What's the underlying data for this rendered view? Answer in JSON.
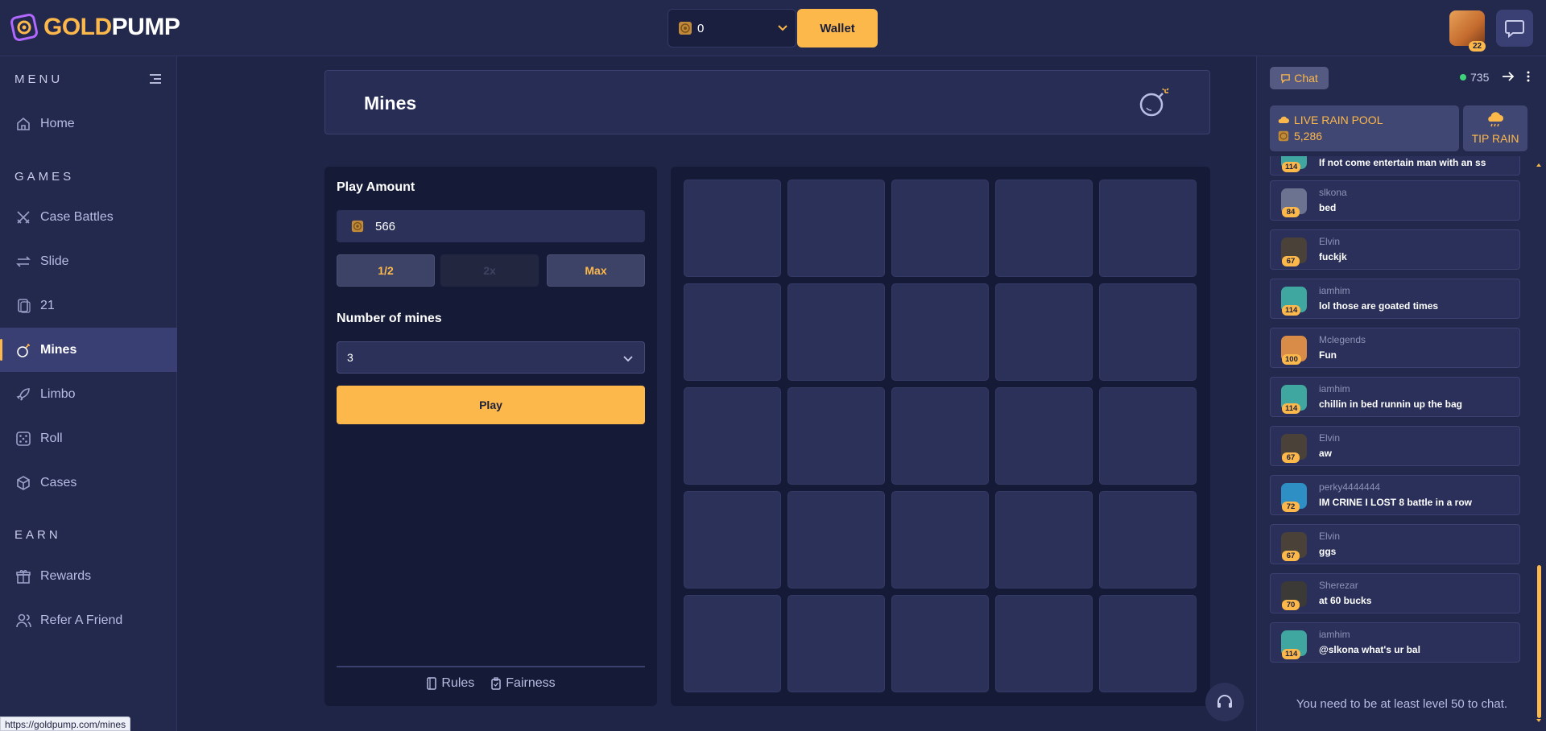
{
  "brand": {
    "name_gold": "GOLD",
    "name_pump": "PUMP"
  },
  "colors": {
    "accent": "#fdb84b",
    "panel": "#272d55",
    "tile": "#2b3159",
    "online": "#3ed27a"
  },
  "header": {
    "balance": "0",
    "wallet_label": "Wallet",
    "user_level": "22"
  },
  "sidebar": {
    "menu_title": "MENU",
    "games_title": "GAMES",
    "earn_title": "EARN",
    "home": {
      "label": "Home",
      "icon": "home-icon"
    },
    "games": [
      {
        "label": "Case Battles",
        "icon": "crossed-swords-icon"
      },
      {
        "label": "Slide",
        "icon": "arrows-left-right-icon"
      },
      {
        "label": "21",
        "icon": "cards-icon"
      },
      {
        "label": "Mines",
        "icon": "bomb-icon",
        "active": true
      },
      {
        "label": "Limbo",
        "icon": "rocket-icon"
      },
      {
        "label": "Roll",
        "icon": "dice-icon"
      },
      {
        "label": "Cases",
        "icon": "box-icon"
      }
    ],
    "earn": [
      {
        "label": "Rewards",
        "icon": "gift-icon"
      },
      {
        "label": "Refer A Friend",
        "icon": "users-icon"
      }
    ]
  },
  "game": {
    "title": "Mines",
    "play_amount_label": "Play Amount",
    "play_amount_value": "566",
    "half_label": "1/2",
    "double_label": "2x",
    "max_label": "Max",
    "mines_label": "Number of mines",
    "mines_value": "3",
    "play_label": "Play",
    "rules_label": "Rules",
    "fairness_label": "Fairness",
    "grid_rows": 5,
    "grid_cols": 5
  },
  "chat": {
    "tab_label": "Chat",
    "online_count": "735",
    "rain_pool_label": "LIVE RAIN POOL",
    "rain_pool_amount": "5,286",
    "tip_rain_label": "TIP RAIN",
    "partial_message": {
      "level": "114",
      "text": "If not come entertain man with an ss"
    },
    "messages": [
      {
        "user": "slkona",
        "level": "84",
        "text": "bed",
        "avatar": "#6b7390"
      },
      {
        "user": "Elvin",
        "level": "67",
        "text": "fuckjk",
        "avatar": "#4a4238"
      },
      {
        "user": "iamhim",
        "level": "114",
        "text": "lol those are goated times",
        "avatar": "#3fa7a0"
      },
      {
        "user": "Mclegends",
        "level": "100",
        "text": "Fun",
        "avatar": "#d98b48"
      },
      {
        "user": "iamhim",
        "level": "114",
        "text": "chillin in bed runnin up the bag",
        "avatar": "#3fa7a0"
      },
      {
        "user": "Elvin",
        "level": "67",
        "text": "aw",
        "avatar": "#4a4238"
      },
      {
        "user": "perky4444444",
        "level": "72",
        "text": "IM CRINE I LOST 8 battle in a row",
        "avatar": "#2d8fc4"
      },
      {
        "user": "Elvin",
        "level": "67",
        "text": "ggs",
        "avatar": "#4a4238"
      },
      {
        "user": "Sherezar",
        "level": "70",
        "text": "at 60 bucks",
        "avatar": "#3b3a36"
      },
      {
        "user": "iamhim",
        "level": "114",
        "text": "@slkona what's ur bal",
        "avatar": "#3fa7a0"
      }
    ],
    "notice": "You need to be at least level 50 to chat."
  },
  "status_url": "https://goldpump.com/mines"
}
